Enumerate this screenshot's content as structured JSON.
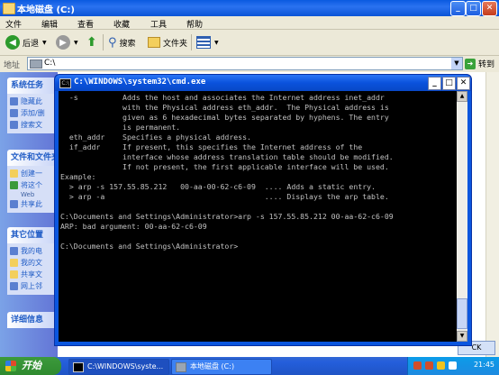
{
  "explorer": {
    "title": "本地磁盘 (C:)",
    "menus": [
      "文件",
      "编辑",
      "查看",
      "收藏",
      "工具",
      "帮助"
    ],
    "toolbar": {
      "back": "后退",
      "search": "搜索",
      "folders": "文件夹"
    },
    "address": {
      "label": "地址",
      "value": "C:\\",
      "go": "转到"
    },
    "panels": [
      {
        "title": "系统任务",
        "items": [
          "隐藏此",
          "添加/删",
          "搜索文"
        ]
      },
      {
        "title": "文件和文件夹",
        "items": [
          "创建一",
          "将这个",
          "共享此"
        ],
        "sub": "Web"
      },
      {
        "title": "其它位置",
        "items": [
          "我的电",
          "我的文",
          "共享文",
          "网上邻"
        ]
      },
      {
        "title": "详细信息",
        "items": []
      }
    ],
    "ime": "CK"
  },
  "cmd": {
    "title": "C:\\WINDOWS\\system32\\cmd.exe",
    "lines": [
      "  -s          Adds the host and associates the Internet address inet_addr",
      "              with the Physical address eth_addr.  The Physical address is",
      "              given as 6 hexadecimal bytes separated by hyphens. The entry",
      "              is permanent.",
      "  eth_addr    Specifies a physical address.",
      "  if_addr     If present, this specifies the Internet address of the",
      "              interface whose address translation table should be modified.",
      "              If not present, the first applicable interface will be used.",
      "Example:",
      "  > arp -s 157.55.85.212   00-aa-00-62-c6-09  .... Adds a static entry.",
      "  > arp -a                                    .... Displays the arp table.",
      "",
      "C:\\Documents and Settings\\Administrator>arp -s 157.55.85.212 00-aa-62-c6-09",
      "ARP: bad argument: 00-aa-62-c6-09",
      "",
      "C:\\Documents and Settings\\Administrator>"
    ]
  },
  "taskbar": {
    "start": "开始",
    "tasks": [
      "C:\\WINDOWS\\syste...",
      "本地磁盘 (C:)"
    ],
    "clock": "21:45"
  }
}
